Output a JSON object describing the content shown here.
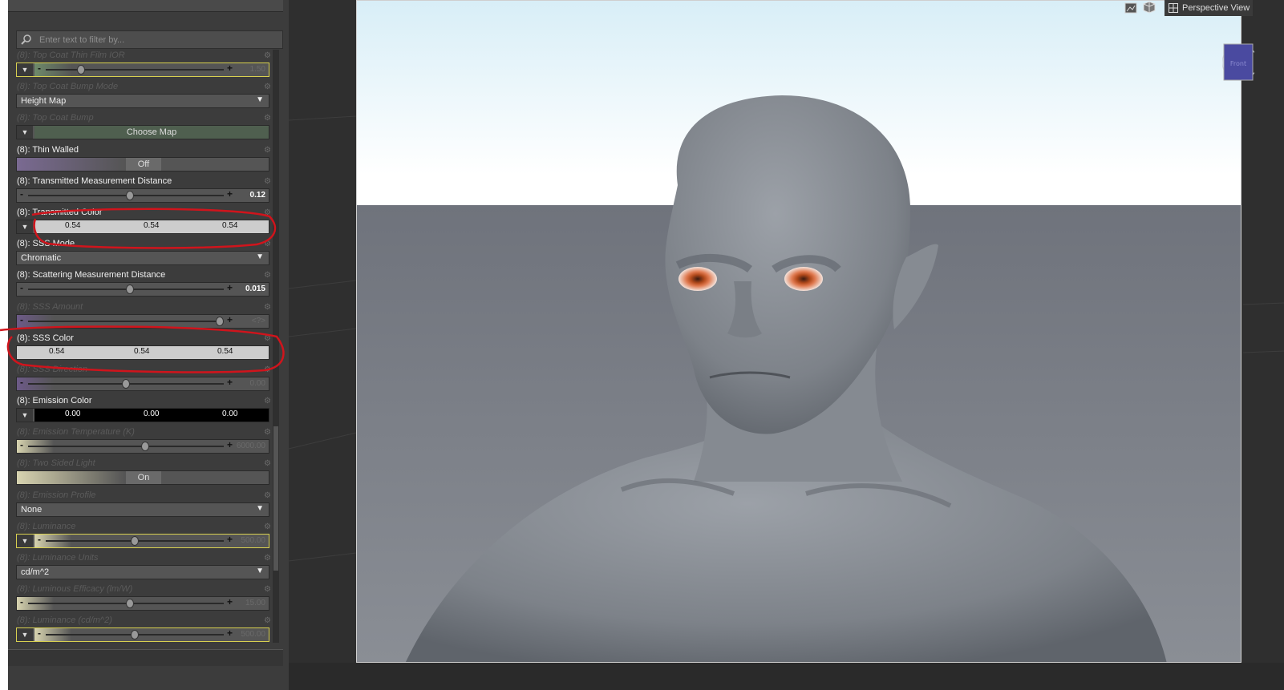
{
  "filter": {
    "placeholder": "Enter text to filter by..."
  },
  "viewport": {
    "view_label": "Perspective View",
    "nav_cube_label": "Front"
  },
  "properties": [
    {
      "label": "(8): Top Coat Thin Film IOR",
      "kind": "slider",
      "dim": true,
      "value": "1.50",
      "level": 0.2,
      "swatch": "#6e8a6a",
      "hl": true
    },
    {
      "label": "(8): Top Coat Bump Mode",
      "kind": "dropdown",
      "dim": true,
      "value": "Height Map"
    },
    {
      "label": "(8): Top Coat Bump",
      "kind": "map",
      "dim": true,
      "value": "Choose Map"
    },
    {
      "label": "(8): Thin Walled",
      "kind": "toggle",
      "dim": false,
      "value": "Off",
      "swatch": "#7a6a92"
    },
    {
      "label": "(8): Transmitted Measurement Distance",
      "kind": "slider",
      "dim": false,
      "value": "0.12",
      "level": 0.52
    },
    {
      "label": "(8): Transmitted Color",
      "kind": "color",
      "dim": false,
      "r": "0.54",
      "g": "0.54",
      "b": "0.54",
      "bg": "#cdcdcd"
    },
    {
      "label": "(8): SSS Mode",
      "kind": "dropdown",
      "dim": false,
      "value": "Chromatic"
    },
    {
      "label": "(8): Scattering Measurement Distance",
      "kind": "slider",
      "dim": false,
      "value": "0.015",
      "level": 0.52
    },
    {
      "label": "(8): SSS Amount",
      "kind": "slider",
      "dim": true,
      "value": "<?>",
      "level": 0.98,
      "swatch": "#6d5a88"
    },
    {
      "label": "(8): SSS Color",
      "kind": "color-noexp",
      "dim": false,
      "r": "0.54",
      "g": "0.54",
      "b": "0.54",
      "bg": "#cdcdcd"
    },
    {
      "label": "(8): SSS Direction",
      "kind": "slider",
      "dim": true,
      "value": "0.00",
      "level": 0.5,
      "swatch": "#6d5a88"
    },
    {
      "label": "(8): Emission Color",
      "kind": "color",
      "dim": false,
      "r": "0.00",
      "g": "0.00",
      "b": "0.00",
      "bg": "#000000",
      "fg": "#ffffff"
    },
    {
      "label": "(8): Emission Temperature (K)",
      "kind": "slider",
      "dim": true,
      "value": "6000.00",
      "level": 0.6,
      "swatch": "#d8d4b0"
    },
    {
      "label": "(8): Two Sided Light",
      "kind": "toggle",
      "dim": true,
      "value": "On",
      "swatch": "#d8d4b0",
      "on": true
    },
    {
      "label": "(8): Emission Profile",
      "kind": "dropdown",
      "dim": true,
      "value": "None"
    },
    {
      "label": "(8): Luminance",
      "kind": "slider-exp",
      "dim": true,
      "value": "500.00",
      "level": 0.5,
      "swatch": "#d8d4b0",
      "hl": true
    },
    {
      "label": "(8): Luminance Units",
      "kind": "dropdown",
      "dim": true,
      "value": "cd/m^2"
    },
    {
      "label": "(8): Luminous Efficacy (lm/W)",
      "kind": "slider",
      "dim": true,
      "value": "15.00",
      "level": 0.52,
      "swatch": "#d8d4b0"
    },
    {
      "label": "(8): Luminance (cd/m^2)",
      "kind": "slider-exp",
      "dim": true,
      "value": "500.00",
      "level": 0.5,
      "swatch": "#d8d4b0",
      "hl": true
    }
  ],
  "colors": {
    "annotation_red": "#d0141c",
    "skin": "#8a8f96"
  }
}
